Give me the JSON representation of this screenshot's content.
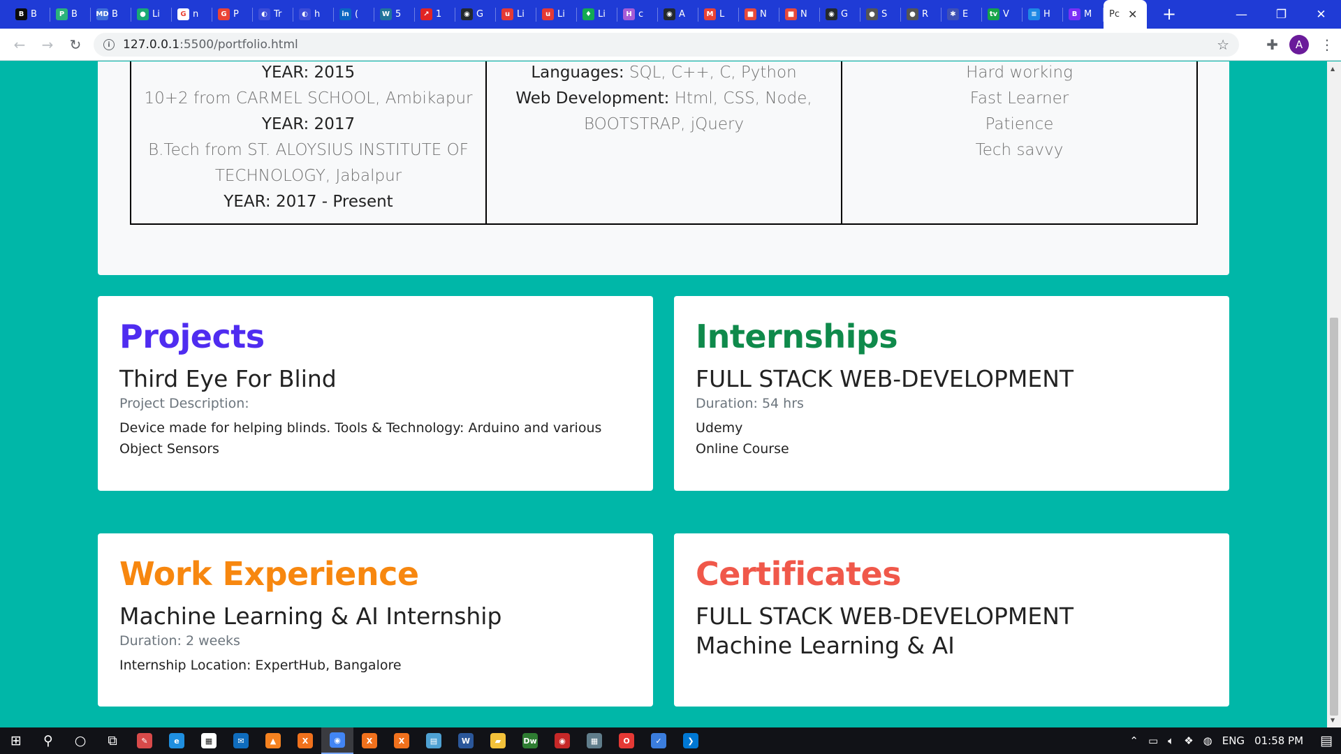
{
  "browser": {
    "tabs": [
      {
        "label": "B",
        "favicon": "B",
        "color": "#0b0b0b"
      },
      {
        "label": "B",
        "favicon": "P",
        "color": "#2bb37b"
      },
      {
        "label": "B",
        "favicon": "MD",
        "color": "#3f6fd8"
      },
      {
        "label": "Li",
        "favicon": "●",
        "color": "#19a974"
      },
      {
        "label": "n",
        "favicon": "G",
        "color": "#ffffff"
      },
      {
        "label": "P",
        "favicon": "G",
        "color": "#ea4335"
      },
      {
        "label": "Tr",
        "favicon": "◐",
        "color": "#3c4cd8"
      },
      {
        "label": "h",
        "favicon": "◐",
        "color": "#3c4cd8"
      },
      {
        "label": "(",
        "favicon": "in",
        "color": "#0a66c2"
      },
      {
        "label": "5",
        "favicon": "W",
        "color": "#21759b"
      },
      {
        "label": "1",
        "favicon": "↗",
        "color": "#e02424"
      },
      {
        "label": "G",
        "favicon": "◉",
        "color": "#24292e"
      },
      {
        "label": "Li",
        "favicon": "u",
        "color": "#e53935"
      },
      {
        "label": "Li",
        "favicon": "u",
        "color": "#e53935"
      },
      {
        "label": "Li",
        "favicon": "♦",
        "color": "#13aa52"
      },
      {
        "label": "c",
        "favicon": "H",
        "color": "#a75cd6"
      },
      {
        "label": "A",
        "favicon": "◉",
        "color": "#24292e"
      },
      {
        "label": "L",
        "favicon": "M",
        "color": "#ea4335"
      },
      {
        "label": "N",
        "favicon": "■",
        "color": "#e8493b"
      },
      {
        "label": "N",
        "favicon": "■",
        "color": "#e8493b"
      },
      {
        "label": "G",
        "favicon": "◉",
        "color": "#24292e"
      },
      {
        "label": "S",
        "favicon": "●",
        "color": "#555555"
      },
      {
        "label": "R",
        "favicon": "●",
        "color": "#555555"
      },
      {
        "label": "E",
        "favicon": "✱",
        "color": "#3f51b5"
      },
      {
        "label": "V",
        "favicon": "tv",
        "color": "#16a34a"
      },
      {
        "label": "H",
        "favicon": "≡",
        "color": "#1e88e5"
      },
      {
        "label": "M",
        "favicon": "B",
        "color": "#7b2ff7"
      }
    ],
    "active_tab": {
      "label": "Pc",
      "favicon": "◐",
      "close": "✕"
    },
    "new_tab": "+",
    "window_controls": {
      "minimize": "—",
      "maximize": "❐",
      "close": "✕"
    },
    "url_host": "127.0.0.1",
    "url_path": ":5500/portfolio.html",
    "profile_initial": "A"
  },
  "education": {
    "col1": [
      {
        "text": "YEAR: 2015",
        "style": "dark"
      },
      {
        "text": "10+2 from CARMEL SCHOOL, Ambikapur",
        "style": "light"
      },
      {
        "text": "YEAR: 2017",
        "style": "dark"
      },
      {
        "text": "B.Tech from ST. ALOYSIUS INSTITUTE OF",
        "style": "light"
      },
      {
        "text": "TECHNOLOGY, Jabalpur",
        "style": "light"
      },
      {
        "text": "YEAR: 2017 - Present",
        "style": "dark"
      }
    ],
    "skills": {
      "languages_label": "Languages:",
      "languages_value": " SQL, C++, C, Python",
      "web_label": "Web Development:",
      "web_value_1": " Html, CSS, Node,",
      "web_value_2": "BOOTSTRAP, jQuery"
    },
    "qualities": [
      "Hard working",
      "Fast Learner",
      "Patience",
      "Tech savvy"
    ]
  },
  "projects": {
    "heading": "Projects",
    "title": "Third Eye For Blind",
    "meta": "Project Description:",
    "description": "Device made for helping blinds. Tools & Technology: Arduino and various Object Sensors",
    "color": "#4f2cf0"
  },
  "internships": {
    "heading": "Internships",
    "title": "FULL STACK WEB-DEVELOPMENT",
    "meta": "Duration: 54 hrs",
    "line1": "Udemy",
    "line2": "Online Course",
    "color": "#0f8a4b"
  },
  "work": {
    "heading": "Work Experience",
    "title": "Machine Learning & AI Internship",
    "meta": "Duration: 2 weeks",
    "line1": "Internship Location: ExpertHub, Bangalore",
    "color": "#f7870f"
  },
  "certificates": {
    "heading": "Certificates",
    "line1": "FULL STACK WEB-DEVELOPMENT",
    "line2": "Machine Learning & AI",
    "color": "#f0584a"
  },
  "taskbar": {
    "apps": [
      {
        "name": "vlc",
        "glyph": "▲",
        "color": "#f58220"
      },
      {
        "name": "xampp-1",
        "glyph": "X",
        "color": "#f0711d"
      },
      {
        "name": "chrome",
        "glyph": "◉",
        "color": "#4285f4"
      },
      {
        "name": "xampp-2",
        "glyph": "X",
        "color": "#f0711d"
      },
      {
        "name": "xampp-3",
        "glyph": "X",
        "color": "#f0711d"
      },
      {
        "name": "notepad",
        "glyph": "▤",
        "color": "#4ea1d3"
      },
      {
        "name": "word",
        "glyph": "W",
        "color": "#2b579a"
      },
      {
        "name": "file-explorer",
        "glyph": "▰",
        "color": "#f3c13a"
      },
      {
        "name": "dreamweaver",
        "glyph": "Dw",
        "color": "#2e7d32"
      },
      {
        "name": "git",
        "glyph": "◉",
        "color": "#c62828"
      },
      {
        "name": "calculator",
        "glyph": "▦",
        "color": "#607d8b"
      },
      {
        "name": "opera",
        "glyph": "O",
        "color": "#e53935"
      },
      {
        "name": "vscode-blue",
        "glyph": "✓",
        "color": "#3b7ddd"
      },
      {
        "name": "vscode",
        "glyph": "❯",
        "color": "#0078d4"
      }
    ],
    "language": "ENG",
    "time": "01:58 PM"
  }
}
